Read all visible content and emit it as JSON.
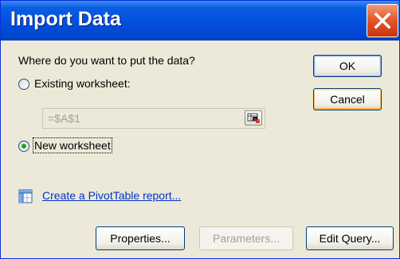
{
  "window": {
    "title": "Import Data"
  },
  "location": {
    "question": "Where do you want to put the data?",
    "existing_label": "Existing worksheet:",
    "reference_value": "=$A$1",
    "new_label": "New worksheet",
    "selected": "new"
  },
  "pivot_link": "Create a PivotTable report...",
  "buttons": {
    "ok": "OK",
    "cancel": "Cancel",
    "properties": "Properties...",
    "parameters": "Parameters...",
    "edit_query": "Edit Query..."
  },
  "colors": {
    "titlebar": "#0351e0",
    "close_button": "#e45a2e",
    "dialog_face": "#ece9d8",
    "link": "#0033cc",
    "radio_selected": "#21a121"
  },
  "icons": {
    "close": "close-icon",
    "collapse_dialog": "collapse-dialog-icon",
    "pivottable": "pivottable-icon"
  }
}
